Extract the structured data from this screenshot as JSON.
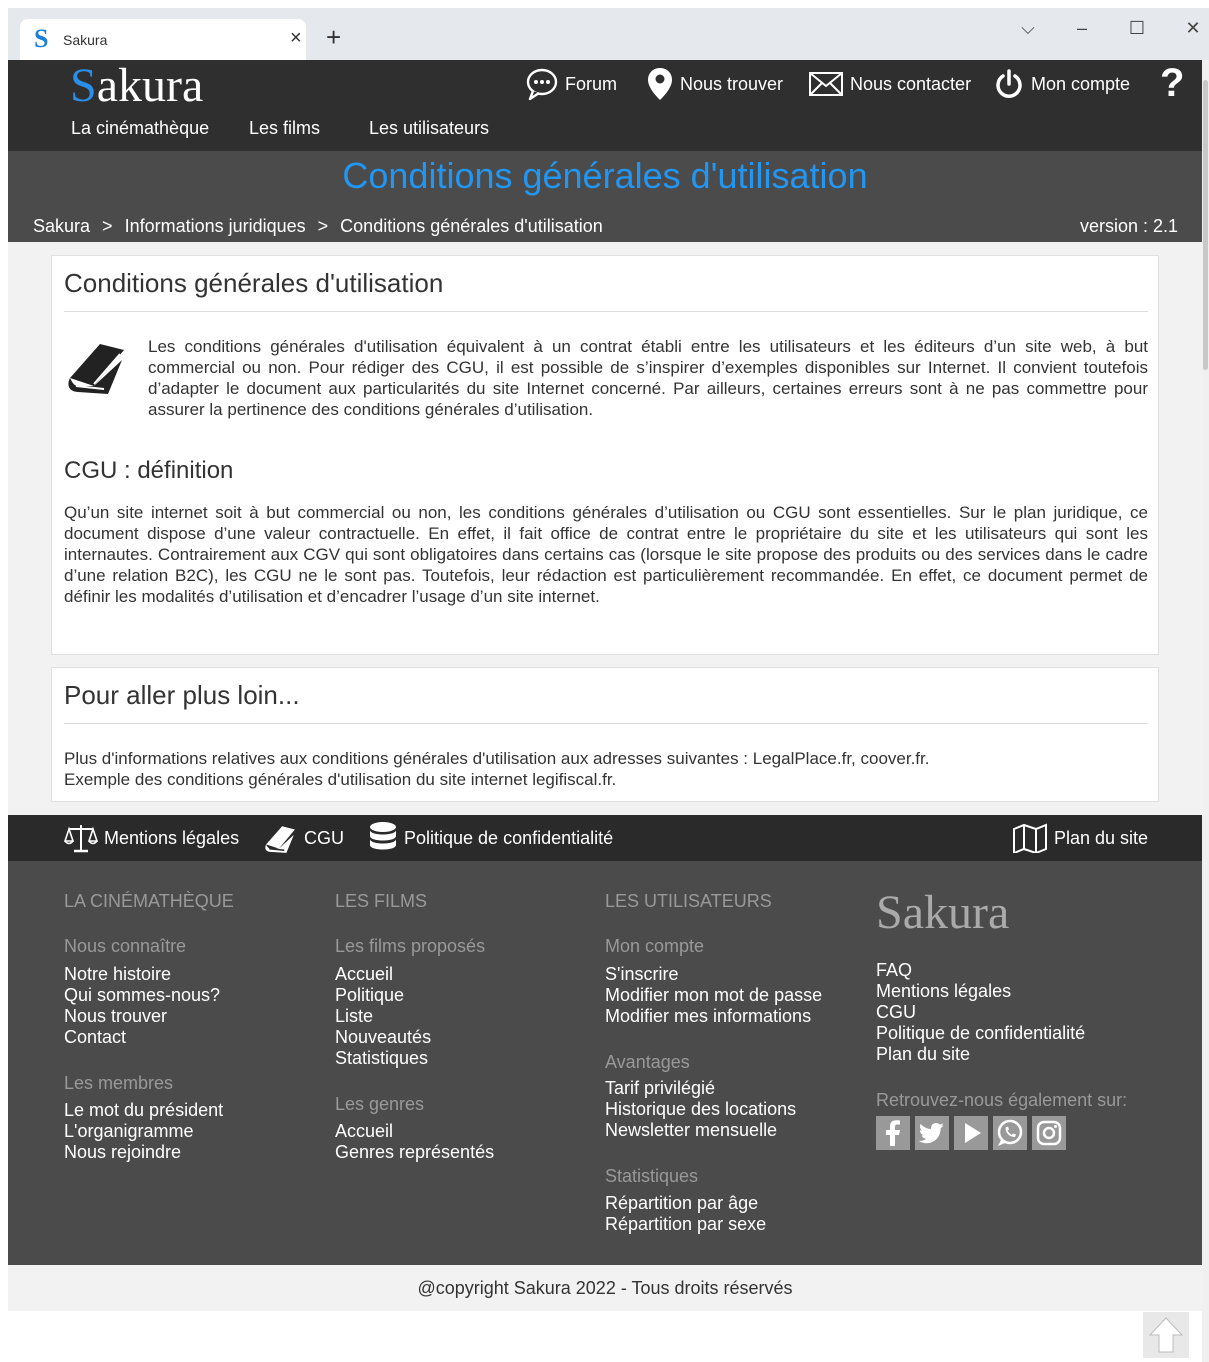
{
  "browser": {
    "tab_title": "Sakura",
    "favicon": "S",
    "tab_close": "×",
    "new_tab": "+",
    "controls": {
      "dropdown": "⌵",
      "minimize": "–",
      "maximize": "☐",
      "close": "✕"
    }
  },
  "header": {
    "logo_initial": "S",
    "logo_rest": "akura",
    "topnav": [
      {
        "label": "Forum",
        "icon": "chat-bubble-icon"
      },
      {
        "label": "Nous trouver",
        "icon": "map-pin-icon"
      },
      {
        "label": "Nous contacter",
        "icon": "envelope-icon"
      },
      {
        "label": "Mon compte",
        "icon": "power-icon"
      }
    ],
    "help": "?",
    "mainnav": [
      "La cinémathèque",
      "Les films",
      "Les utilisateurs"
    ]
  },
  "title_band": {
    "title": "Conditions générales d'utilisation",
    "breadcrumb": [
      "Sakura",
      "Informations juridiques",
      "Conditions générales d'utilisation"
    ],
    "breadcrumb_sep": ">",
    "version": "version : 2.1"
  },
  "main": {
    "card1": {
      "heading": "Conditions générales d'utilisation",
      "intro": "Les conditions générales d'utilisation équivalent à un contrat établi entre les utilisateurs et les éditeurs d’un site web, à but commercial ou non. Pour rédiger des CGU, il est possible de s’inspirer d’exemples disponibles sur Internet. Il convient toutefois d’adapter le document aux particularités du site Internet concerné. Par ailleurs, certaines erreurs sont à ne pas commettre pour assurer la pertinence des conditions générales d’utilisation.",
      "subheading": "CGU : définition",
      "definition": "Qu’un site internet soit à but commercial ou non, les conditions générales d’utilisation ou CGU sont essentielles. Sur le plan juridique, ce document dispose d’une valeur contractuelle. En effet, il fait office de contrat entre le propriétaire du site et les utilisateurs qui sont les internautes. Contrairement aux CGV qui sont obligatoires dans certains cas (lorsque le site propose des produits ou des services dans le cadre d’une relation B2C), les CGU ne le sont pas. Toutefois, leur rédaction est particulièrement recommandée. En effet, ce document permet de définir les modalités d’utilisation et d’encadrer l’usage d’un site internet."
    },
    "card2": {
      "heading": "Pour aller plus loin...",
      "line1": "Plus d'informations relatives aux conditions générales d'utilisation aux adresses suivantes : LegalPlace.fr, coover.fr.",
      "line2": "Exemple des conditions générales d'utilisation du site internet legifiscal.fr."
    }
  },
  "footer_bar": {
    "mentions": "Mentions légales",
    "cgu": "CGU",
    "privacy": "Politique de confidentialité",
    "sitemap": "Plan du site"
  },
  "footer": {
    "col1": {
      "heading": "LA CINÉMATHÈQUE",
      "sub1": "Nous connaître",
      "links1": [
        "Notre histoire",
        "Qui sommes-nous?",
        "Nous trouver",
        "Contact"
      ],
      "sub2": "Les membres",
      "links2": [
        "Le mot du président",
        "L'organigramme",
        "Nous rejoindre"
      ]
    },
    "col2": {
      "heading": "LES FILMS",
      "sub1": "Les films proposés",
      "links1": [
        "Accueil",
        "Politique",
        "Liste",
        "Nouveautés",
        "Statistiques"
      ],
      "sub2": "Les genres",
      "links2": [
        "Accueil",
        "Genres représentés"
      ]
    },
    "col3": {
      "heading": "LES UTILISATEURS",
      "sub1": "Mon compte",
      "links1": [
        "S'inscrire",
        "Modifier mon mot de passe",
        "Modifier mes informations"
      ],
      "sub2": "Avantages",
      "links2": [
        "Tarif privilégié",
        "Historique des locations",
        "Newsletter mensuelle"
      ],
      "sub3": "Statistiques",
      "links3": [
        "Répartition par âge",
        "Répartition par sexe"
      ]
    },
    "col4": {
      "logo": "Sakura",
      "links": [
        "FAQ",
        "Mentions légales",
        "CGU",
        "Politique de confidentialité",
        "Plan du site"
      ],
      "social_label": "Retrouvez-nous également sur:",
      "social": [
        "facebook-icon",
        "twitter-icon",
        "youtube-icon",
        "whatsapp-icon",
        "instagram-icon"
      ]
    },
    "copyright": "@copyright Sakura 2022 - Tous droits réservés"
  }
}
